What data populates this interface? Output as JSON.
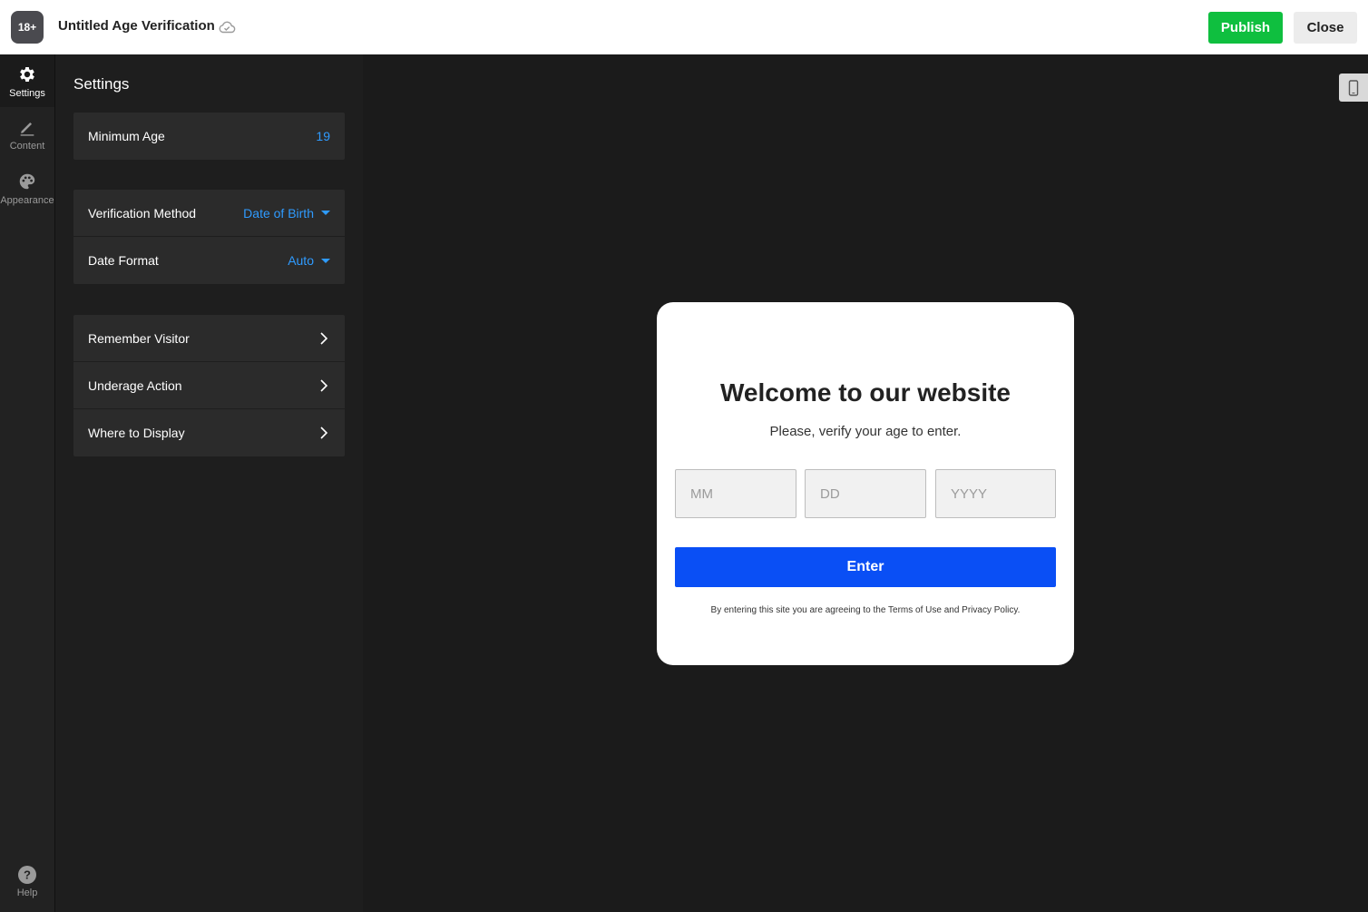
{
  "topbar": {
    "logo_text": "18+",
    "title": "Untitled Age Verification",
    "save_status_icon": "cloud-check-icon",
    "publish_label": "Publish",
    "close_label": "Close",
    "publish_color": "#0fbf3f"
  },
  "rail": {
    "items": [
      {
        "label": "Settings",
        "icon": "gear-icon",
        "active": true
      },
      {
        "label": "Content",
        "icon": "pencil-icon",
        "active": false
      },
      {
        "label": "Appearance",
        "icon": "palette-icon",
        "active": false
      }
    ],
    "help_label": "Help",
    "help_icon": "question-circle-icon"
  },
  "panel": {
    "title": "Settings",
    "minimum_age": {
      "label": "Minimum Age",
      "value": "19"
    },
    "verification_method": {
      "label": "Verification Method",
      "value": "Date of Birth"
    },
    "date_format": {
      "label": "Date Format",
      "value": "Auto"
    },
    "links": [
      {
        "label": "Remember Visitor"
      },
      {
        "label": "Underage Action"
      },
      {
        "label": "Where to Display"
      }
    ],
    "accent_color": "#2f9bff"
  },
  "preview": {
    "device_icon": "mobile-phone-icon",
    "heading": "Welcome to our website",
    "subheading": "Please, verify your age to enter.",
    "month_placeholder": "MM",
    "day_placeholder": "DD",
    "year_placeholder": "YYYY",
    "enter_label": "Enter",
    "terms": "By entering this site you are agreeing to the Terms of Use and Privacy Policy.",
    "button_color": "#0a4ff5"
  }
}
